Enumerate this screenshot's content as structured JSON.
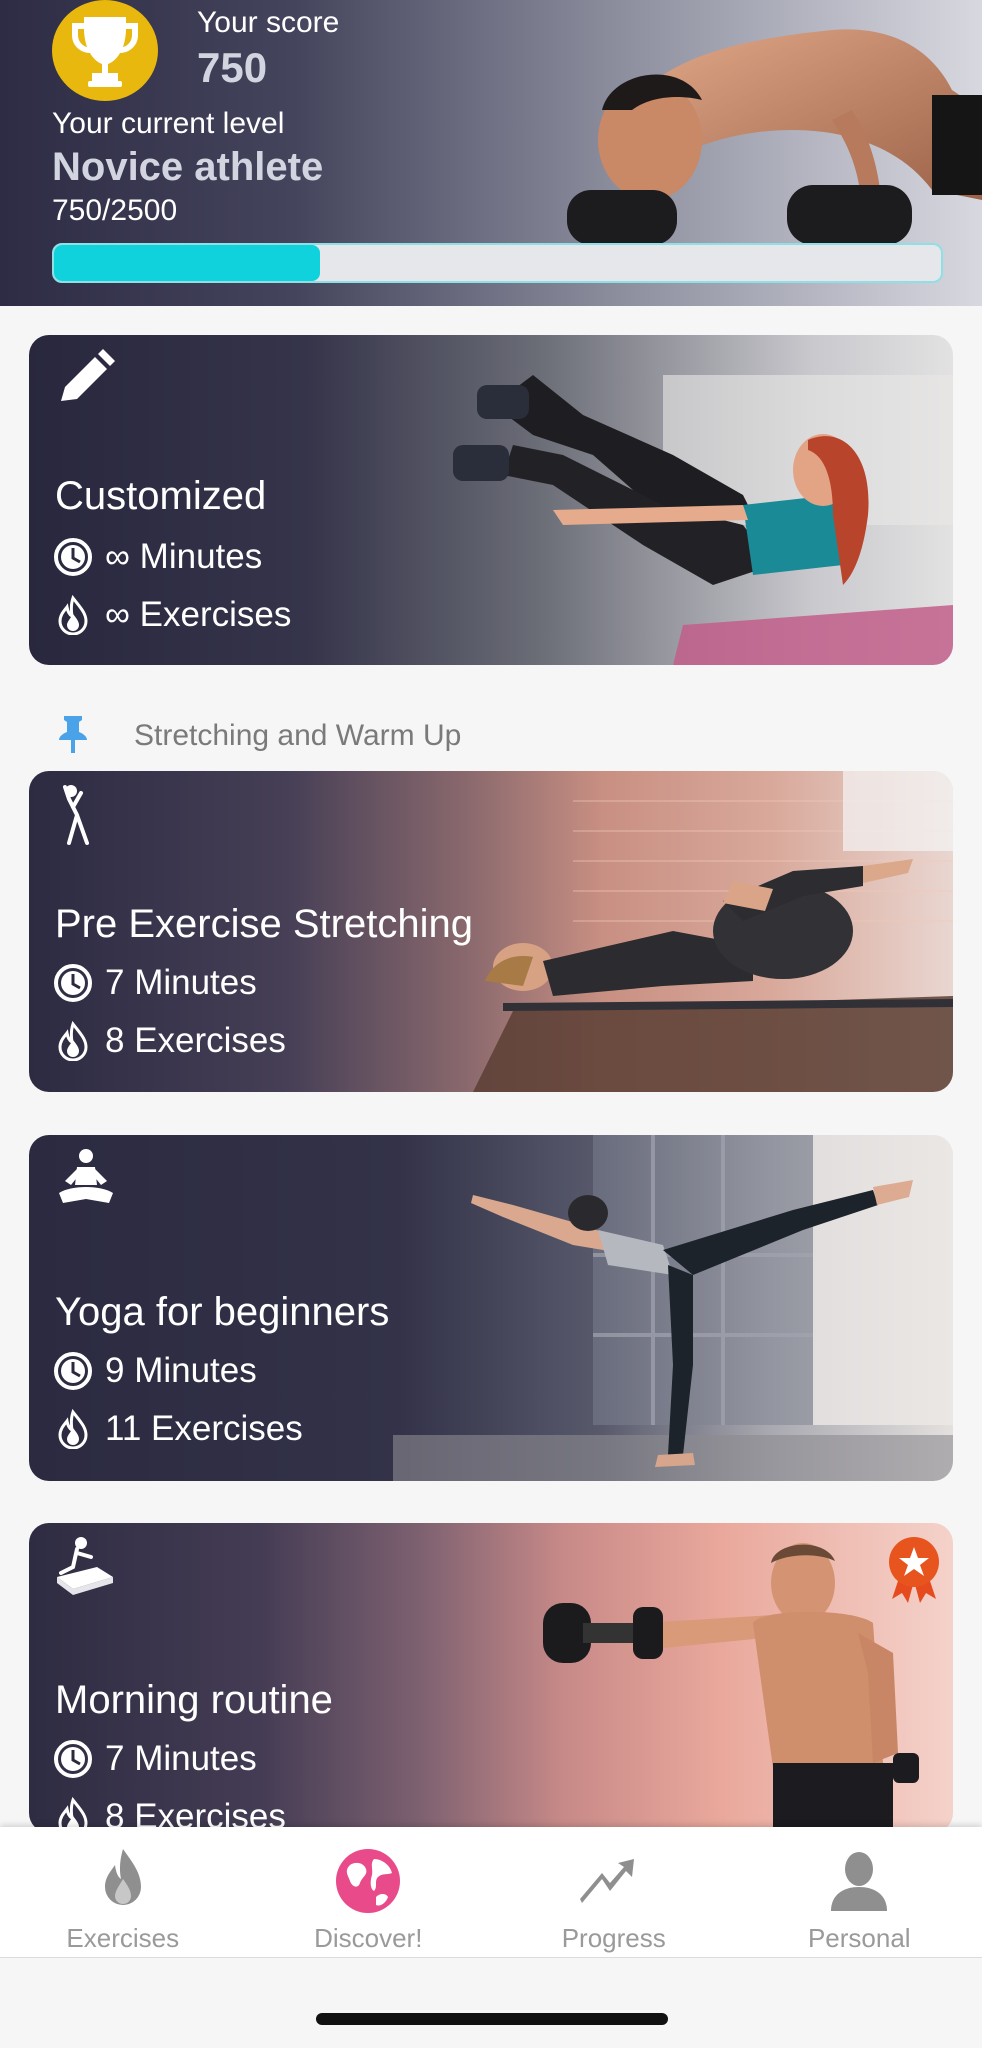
{
  "header": {
    "score_label": "Your score",
    "score_value": "750",
    "level_label": "Your current level",
    "level_name": "Novice athlete",
    "level_progress_text": "750/2500",
    "progress_fraction": 0.3,
    "trophy_icon": "trophy-icon",
    "colors": {
      "trophy": "#e8b80e",
      "progress_fill": "#10d2dd",
      "progress_track": "#e5e7ea"
    }
  },
  "cards": {
    "customized": {
      "icon": "pencil-icon",
      "title": "Customized",
      "minutes": "∞ Minutes",
      "exercises": "∞ Exercises"
    },
    "stretch": {
      "icon": "stretching-figure-icon",
      "title": "Pre Exercise Stretching",
      "minutes": "7 Minutes",
      "exercises": "8 Exercises"
    },
    "yoga": {
      "icon": "yoga-lotus-icon",
      "title": "Yoga for beginners",
      "minutes": "9 Minutes",
      "exercises": "11 Exercises"
    },
    "morning": {
      "icon": "morning-routine-icon",
      "badge": "star-ribbon-badge-icon",
      "title": "Morning routine",
      "minutes": "7 Minutes",
      "exercises": "8 Exercises"
    }
  },
  "section": {
    "pin_icon": "pin-icon",
    "title": "Stretching and Warm Up",
    "pin_color": "#4aa3e8"
  },
  "nav": {
    "items": [
      {
        "label": "Exercises",
        "icon": "flame-icon"
      },
      {
        "label": "Discover!",
        "icon": "globe-icon",
        "active": true,
        "color": "#e84a8a"
      },
      {
        "label": "Progress",
        "icon": "trend-up-icon"
      },
      {
        "label": "Personal",
        "icon": "person-icon"
      }
    ]
  }
}
